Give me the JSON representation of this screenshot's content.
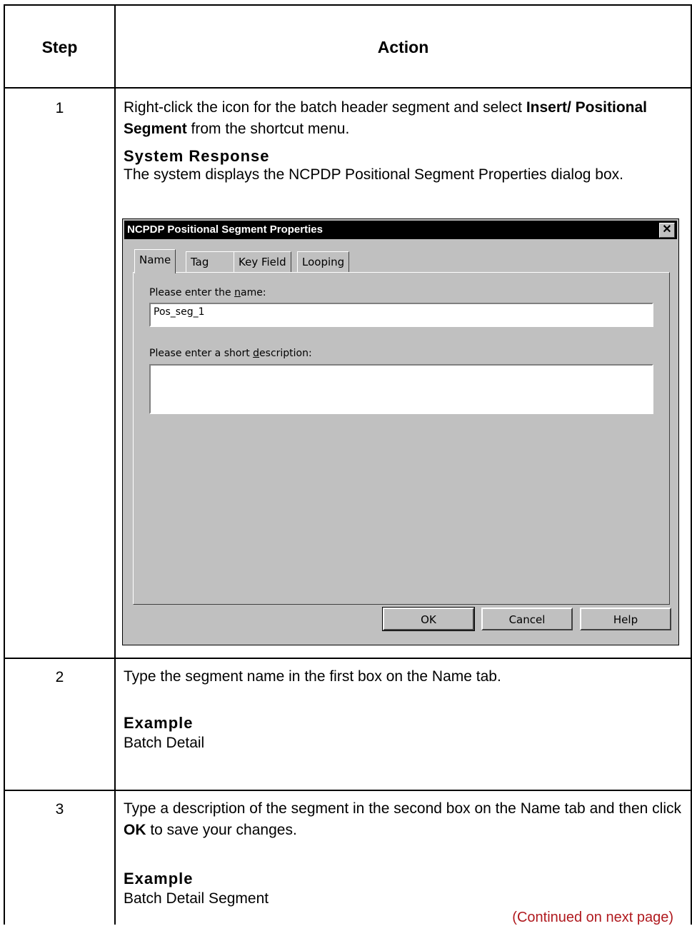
{
  "table": {
    "header": {
      "step": "Step",
      "action": "Action"
    },
    "rows": [
      {
        "step": "1",
        "text_before": "Right-click the icon for the batch header segment and select ",
        "bold": "Insert/ Positional Segment",
        "text_after": " from the shortcut menu.",
        "subhead": "System Response",
        "subtext": "The system displays the NCPDP Positional Segment Properties dialog box."
      },
      {
        "step": "2",
        "text": "Type the segment name in the first box on the Name tab.",
        "subhead": "Example",
        "subtext": "Batch Detail"
      },
      {
        "step": "3",
        "text_before": "Type a description of the segment in the second box on the Name tab and then click ",
        "bold": "OK",
        "text_after": " to save your changes.",
        "subhead": "Example",
        "subtext": "Batch Detail Segment"
      }
    ],
    "continued": "(Continued on next page)"
  },
  "dialog": {
    "title": "NCPDP Positional Segment Properties",
    "close_glyph": "✕",
    "tabs": [
      "Name",
      "Tag",
      "Key Field",
      "Looping"
    ],
    "name_label_pre": "Please enter the ",
    "name_label_u": "n",
    "name_label_post": "ame:",
    "name_value": "Pos_seg_1",
    "desc_label_pre": "Please enter a short ",
    "desc_label_u": "d",
    "desc_label_post": "escription:",
    "desc_value": "",
    "buttons": {
      "ok": "OK",
      "cancel": "Cancel",
      "help": "Help"
    }
  },
  "colors": {
    "continued": "#b0191e",
    "titlebar": "#000000",
    "dialog_bg": "#c0c0c0"
  }
}
